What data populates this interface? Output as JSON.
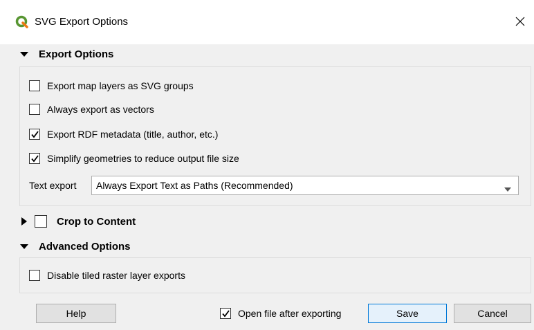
{
  "window": {
    "title": "SVG Export Options",
    "close_icon": "close-icon",
    "app_icon": "qgis-logo-icon"
  },
  "export_options": {
    "header": "Export Options",
    "items": [
      {
        "label": "Export map layers as SVG groups",
        "checked": false
      },
      {
        "label": "Always export as vectors",
        "checked": false
      },
      {
        "label": "Export RDF metadata (title, author, etc.)",
        "checked": true
      },
      {
        "label": "Simplify geometries to reduce output file size",
        "checked": true
      }
    ],
    "text_export": {
      "label": "Text export",
      "value": "Always Export Text as Paths (Recommended)"
    }
  },
  "crop": {
    "label": "Crop to Content",
    "checked": false,
    "expanded": false
  },
  "advanced_options": {
    "header": "Advanced Options",
    "items": [
      {
        "label": "Disable tiled raster layer exports",
        "checked": false
      }
    ]
  },
  "footer": {
    "help_label": "Help",
    "open_after_label": "Open file after exporting",
    "open_after_checked": true,
    "save_label": "Save",
    "cancel_label": "Cancel"
  },
  "colors": {
    "accent": "#0078d7",
    "qgis_green": "#589632",
    "qgis_yellow": "#ee7913"
  }
}
